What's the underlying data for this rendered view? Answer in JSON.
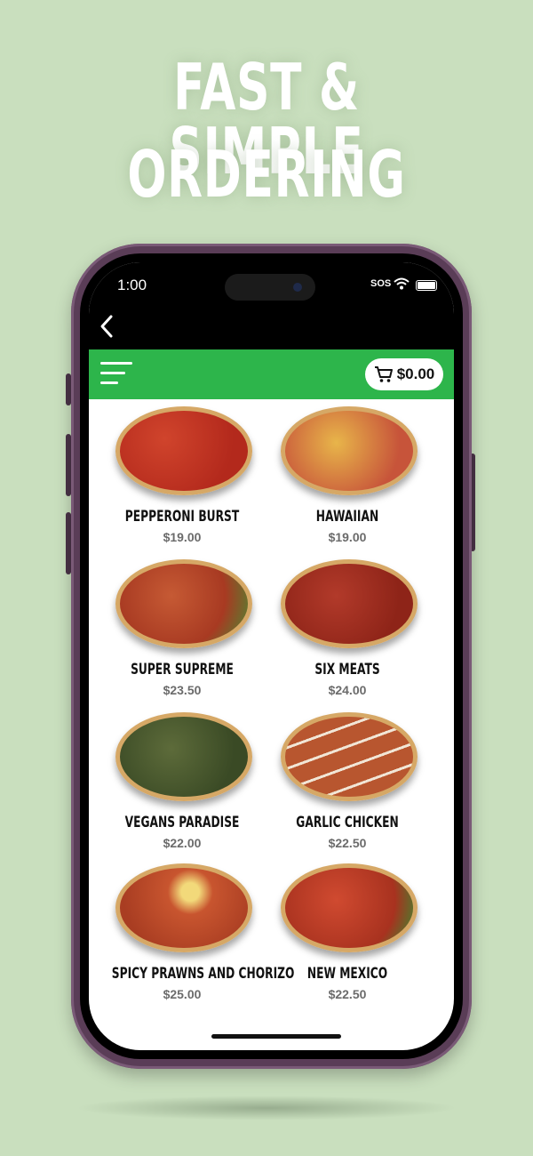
{
  "headline": {
    "line1": "FAST & SIMPLE",
    "line2": "ORDERING"
  },
  "status": {
    "time": "1:00",
    "sos": "SOS"
  },
  "cart": {
    "total": "$0.00"
  },
  "colors": {
    "background": "#c9dfbe",
    "appbar": "#2db54b",
    "phone_frame": "#5a3d57"
  },
  "icons": {
    "back": "chevron-left-icon",
    "menu": "hamburger-menu-icon",
    "cart": "cart-icon"
  },
  "products": [
    {
      "name": "PEPPERONI BURST",
      "price": "$19.00"
    },
    {
      "name": "HAWAIIAN",
      "price": "$19.00"
    },
    {
      "name": "SUPER SUPREME",
      "price": "$23.50"
    },
    {
      "name": "SIX MEATS",
      "price": "$24.00"
    },
    {
      "name": "VEGANS PARADISE",
      "price": "$22.00"
    },
    {
      "name": "GARLIC CHICKEN",
      "price": "$22.50"
    },
    {
      "name": "SPICY PRAWNS AND CHORIZO",
      "price": "$25.00"
    },
    {
      "name": "NEW MEXICO",
      "price": "$22.50"
    }
  ]
}
